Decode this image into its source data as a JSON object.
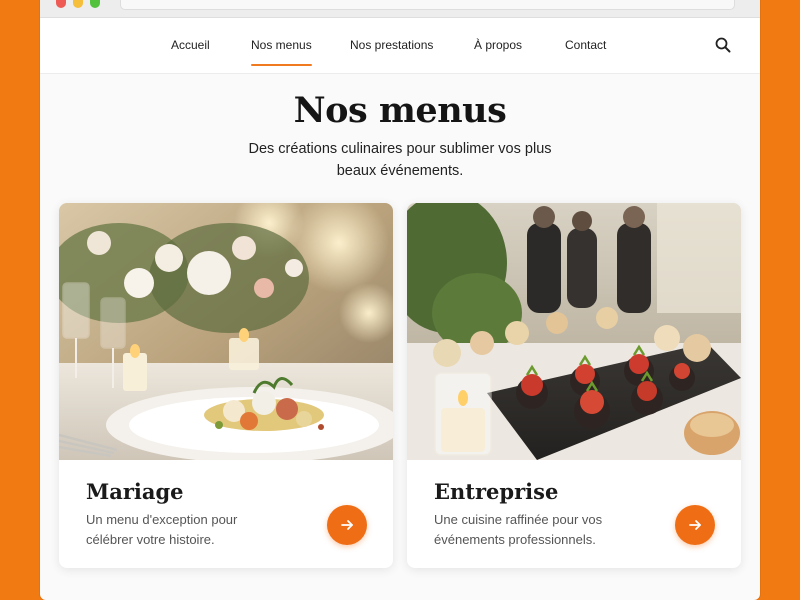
{
  "colors": {
    "background": "#f27a12",
    "accent": "#ef6d14",
    "active_underline": "#ef7a1f"
  },
  "nav": {
    "items": [
      {
        "label": "Accueil",
        "active": false
      },
      {
        "label": "Nos menus",
        "active": true
      },
      {
        "label": "Nos prestations",
        "active": false
      },
      {
        "label": "À propos",
        "active": false
      },
      {
        "label": "Contact",
        "active": false
      }
    ],
    "search_icon": "search-icon"
  },
  "hero": {
    "title": "Nos menus",
    "subtitle": "Des créations culinaires pour sublimer vos plus beaux événements."
  },
  "cards": [
    {
      "title": "Mariage",
      "description": "Un menu d'exception pour célébrer votre histoire.",
      "image": "wedding-table-plated-dish-photo",
      "button_icon": "arrow-right-icon"
    },
    {
      "title": "Entreprise",
      "description": "Une cuisine raffinée pour vos événements professionnels.",
      "image": "corporate-buffet-canapes-photo",
      "button_icon": "arrow-right-icon"
    }
  ]
}
